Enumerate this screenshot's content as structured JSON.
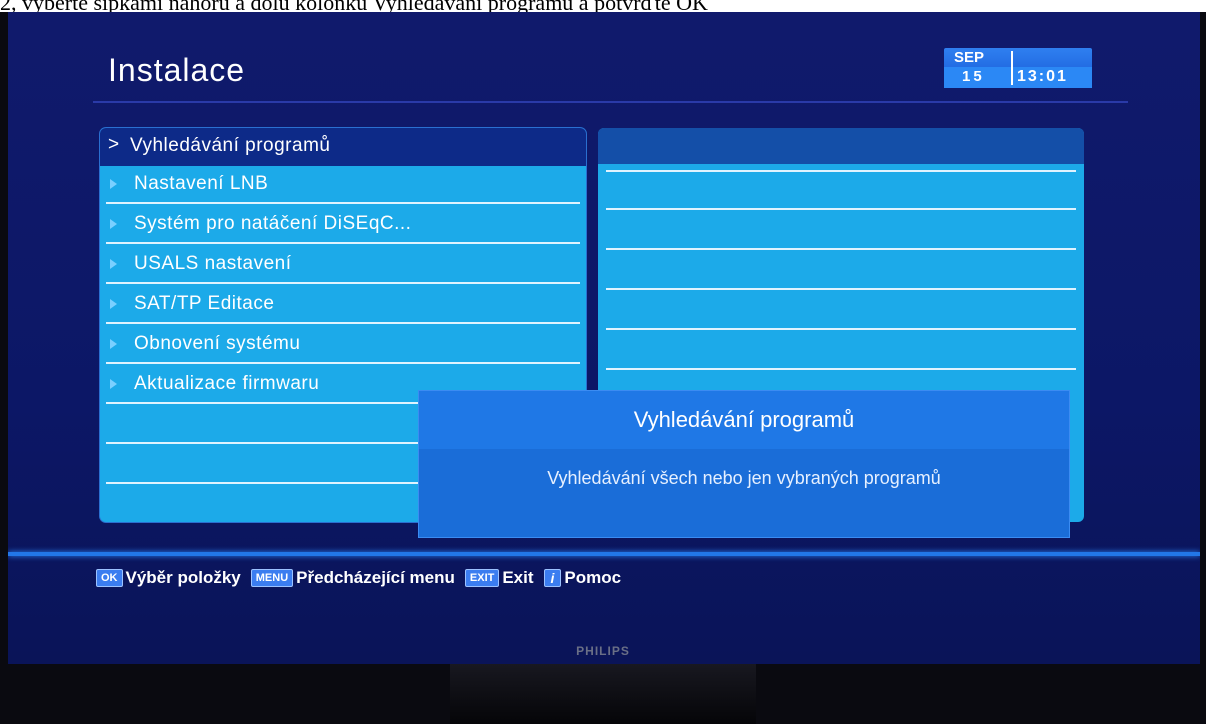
{
  "caption": "2, vyberte šipkami nahoru a dolů kolonku Vyhledávání programů a potvrďte OK",
  "header": {
    "title": "Instalace",
    "clock": {
      "month": "SEP",
      "day": "15",
      "time": "13:01"
    }
  },
  "menu": {
    "items": [
      {
        "label": "Vyhledávání programů",
        "selected": true
      },
      {
        "label": "Nastavení LNB"
      },
      {
        "label": "Systém pro natáčení DiSEqC..."
      },
      {
        "label": "USALS nastavení"
      },
      {
        "label": "SAT/TP Editace"
      },
      {
        "label": "Obnovení systému"
      },
      {
        "label": "Aktualizace firmwaru"
      }
    ],
    "selected_marker": ">"
  },
  "popup": {
    "title": "Vyhledávání programů",
    "text": "Vyhledávání všech nebo jen vybraných programů"
  },
  "footer": {
    "ok_key": "OK",
    "ok_label": "Výběr položky",
    "menu_key": "MENU",
    "menu_label": "Předcházející menu",
    "exit_key": "EXIT",
    "exit_label": "Exit",
    "info_key": "i",
    "info_label": "Pomoc"
  },
  "brand": "PHILIPS",
  "colors": {
    "menu_bg": "#1caae9",
    "screen_bg": "#101a6c",
    "popup_bg": "#1a6dd8",
    "selected_bg": "#0d2a88"
  }
}
